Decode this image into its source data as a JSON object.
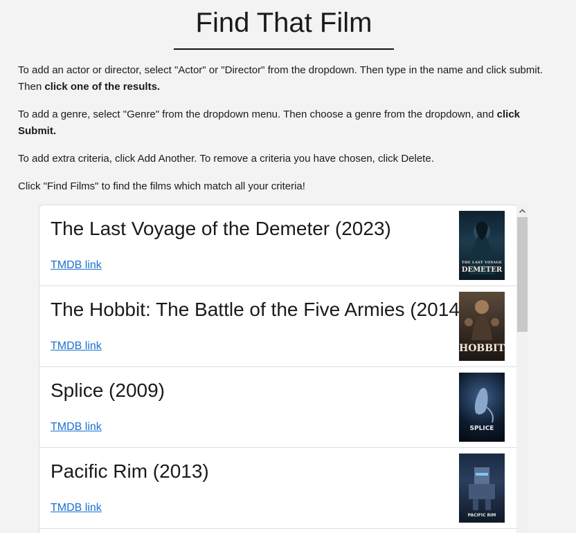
{
  "page": {
    "title": "Find That Film"
  },
  "instructions": {
    "p1_text": "To add an actor or director, select \"Actor\" or \"Director\" from the dropdown. Then type in the name and click submit. Then ",
    "p1_bold": "click one of the results.",
    "p2_text": "To add a genre, select \"Genre\" from the dropdown menu. Then choose a genre from the dropdown, and ",
    "p2_bold": "click Submit.",
    "p3_text": "To add extra criteria, click Add Another. To remove a criteria you have chosen, click Delete.",
    "p4_text": "Click \"Find Films\" to find the films which match all your criteria!"
  },
  "results": [
    {
      "title": "The Last Voyage of the Demeter (2023)",
      "link_label": "TMDB link",
      "poster_caption": "LAST VOYAGE DEMETER",
      "poster_icon": "ghostly-figure-poster"
    },
    {
      "title": "The Hobbit: The Battle of the Five Armies (2014)",
      "link_label": "TMDB link",
      "poster_caption": "HOBBIT",
      "poster_icon": "warriors-poster"
    },
    {
      "title": "Splice (2009)",
      "link_label": "TMDB link",
      "poster_caption": "SPLICE",
      "poster_icon": "creature-poster"
    },
    {
      "title": "Pacific Rim (2013)",
      "link_label": "TMDB link",
      "poster_caption": "PACIFIC RIM",
      "poster_icon": "robot-poster"
    }
  ],
  "colors": {
    "link": "#1a6fd1",
    "background": "#f3f3f3",
    "card_background": "#ffffff"
  },
  "scrollbar": {
    "icon": "chevron-up-icon"
  }
}
